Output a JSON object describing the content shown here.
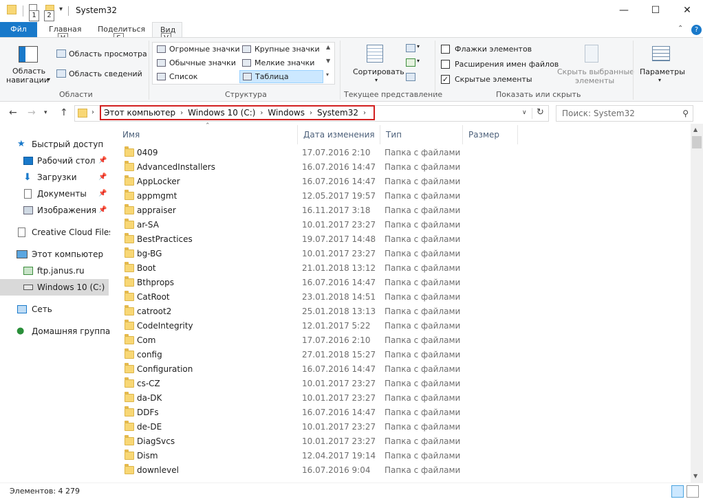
{
  "window": {
    "title": "System32",
    "quick_access_keytips": [
      "1",
      "2"
    ],
    "controls": {
      "minimize": "—",
      "maximize": "☐",
      "close": "✕"
    }
  },
  "ribbon": {
    "tabs": [
      {
        "label": "Фйл",
        "keytip": ""
      },
      {
        "label": "Главная",
        "keytip": "H"
      },
      {
        "label": "Поделиться",
        "keytip": "S"
      },
      {
        "label": "Вид",
        "keytip": "V"
      }
    ],
    "panes_group": {
      "label": "Области",
      "nav_pane_label_1": "Область",
      "nav_pane_label_2": "навигации",
      "preview": "Область просмотра",
      "details": "Область сведений"
    },
    "layout_group": {
      "label": "Структура",
      "items": [
        "Огромные значки",
        "Крупные значки",
        "Обычные значки",
        "Мелкие значки",
        "Список",
        "Таблица"
      ],
      "selected": "Таблица"
    },
    "current_view_group": {
      "label": "Текущее представление",
      "sort": "Сортировать"
    },
    "show_hide_group": {
      "label": "Показать или скрыть",
      "checkboxes": [
        {
          "label": "Флажки элементов",
          "checked": false
        },
        {
          "label": "Расширения имен файлов",
          "checked": false
        },
        {
          "label": "Скрытые элементы",
          "checked": true
        }
      ],
      "hide_selected_1": "Скрыть выбранные",
      "hide_selected_2": "элементы"
    },
    "options": "Параметры"
  },
  "address": {
    "breadcrumbs": [
      "Этот компьютер",
      "Windows 10 (C:)",
      "Windows",
      "System32"
    ],
    "search_placeholder": "Поиск: System32"
  },
  "nav_pane": {
    "items": [
      {
        "label": "Быстрый доступ",
        "icon": "star-icon",
        "pinned": false
      },
      {
        "label": "Рабочий стол",
        "icon": "desktop-icon",
        "pinned": true
      },
      {
        "label": "Загрузки",
        "icon": "download-icon",
        "pinned": true
      },
      {
        "label": "Документы",
        "icon": "document-icon",
        "pinned": true
      },
      {
        "label": "Изображения",
        "icon": "pictures-icon",
        "pinned": true
      },
      {
        "label": "Creative Cloud Files",
        "icon": "file-icon",
        "pinned": false
      },
      {
        "label": "Этот компьютер",
        "icon": "computer-icon",
        "pinned": false
      },
      {
        "label": "ftp.janus.ru",
        "icon": "ftp-icon",
        "pinned": false
      },
      {
        "label": "Windows 10 (C:)",
        "icon": "drive-icon",
        "pinned": false
      },
      {
        "label": "Сеть",
        "icon": "network-icon",
        "pinned": false
      },
      {
        "label": "Домашняя группа",
        "icon": "homegroup-icon",
        "pinned": false
      }
    ],
    "selected": "Windows 10 (C:)"
  },
  "file_list": {
    "columns": [
      "Имя",
      "Дата изменения",
      "Тип",
      "Размер"
    ],
    "rows": [
      {
        "name": "0409",
        "date": "17.07.2016 2:10",
        "type": "Папка с файлами"
      },
      {
        "name": "AdvancedInstallers",
        "date": "16.07.2016 14:47",
        "type": "Папка с файлами"
      },
      {
        "name": "AppLocker",
        "date": "16.07.2016 14:47",
        "type": "Папка с файлами"
      },
      {
        "name": "appmgmt",
        "date": "12.05.2017 19:57",
        "type": "Папка с файлами"
      },
      {
        "name": "appraiser",
        "date": "16.11.2017 3:18",
        "type": "Папка с файлами"
      },
      {
        "name": "ar-SA",
        "date": "10.01.2017 23:27",
        "type": "Папка с файлами"
      },
      {
        "name": "BestPractices",
        "date": "19.07.2017 14:48",
        "type": "Папка с файлами"
      },
      {
        "name": "bg-BG",
        "date": "10.01.2017 23:27",
        "type": "Папка с файлами"
      },
      {
        "name": "Boot",
        "date": "21.01.2018 13:12",
        "type": "Папка с файлами"
      },
      {
        "name": "Bthprops",
        "date": "16.07.2016 14:47",
        "type": "Папка с файлами"
      },
      {
        "name": "CatRoot",
        "date": "23.01.2018 14:51",
        "type": "Папка с файлами"
      },
      {
        "name": "catroot2",
        "date": "25.01.2018 13:13",
        "type": "Папка с файлами"
      },
      {
        "name": "CodeIntegrity",
        "date": "12.01.2017 5:22",
        "type": "Папка с файлами"
      },
      {
        "name": "Com",
        "date": "17.07.2016 2:10",
        "type": "Папка с файлами"
      },
      {
        "name": "config",
        "date": "27.01.2018 15:27",
        "type": "Папка с файлами"
      },
      {
        "name": "Configuration",
        "date": "16.07.2016 14:47",
        "type": "Папка с файлами"
      },
      {
        "name": "cs-CZ",
        "date": "10.01.2017 23:27",
        "type": "Папка с файлами"
      },
      {
        "name": "da-DK",
        "date": "10.01.2017 23:27",
        "type": "Папка с файлами"
      },
      {
        "name": "DDFs",
        "date": "16.07.2016 14:47",
        "type": "Папка с файлами"
      },
      {
        "name": "de-DE",
        "date": "10.01.2017 23:27",
        "type": "Папка с файлами"
      },
      {
        "name": "DiagSvcs",
        "date": "10.01.2017 23:27",
        "type": "Папка с файлами"
      },
      {
        "name": "Dism",
        "date": "12.04.2017 19:14",
        "type": "Папка с файлами"
      },
      {
        "name": "downlevel",
        "date": "16.07.2016 9:04",
        "type": "Папка с файлами"
      }
    ]
  },
  "status": {
    "items_count": "Элементов: 4 279"
  }
}
